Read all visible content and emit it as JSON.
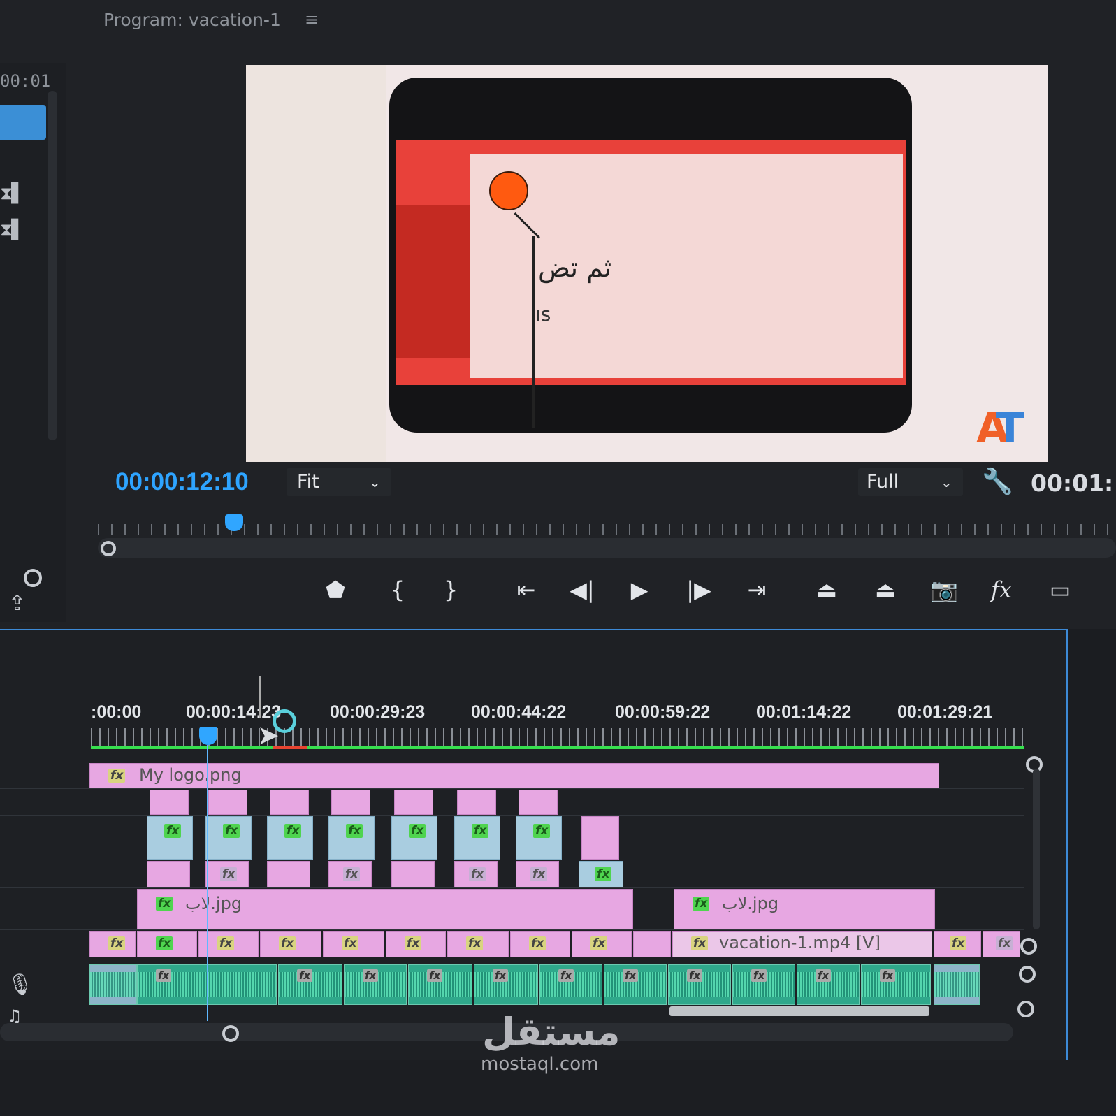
{
  "program_monitor": {
    "title": "Program: vacation-1",
    "menu_icon": "hamburger-icon",
    "current_timecode": "00:00:12:10",
    "fit_select": "Fit",
    "quality_select": "Full",
    "end_timecode": "00:01:",
    "left_panel_timecode": "00:01",
    "overlay_arabic_text": "ثم تض",
    "overlay_sub_text": "ıs",
    "logo_text": "AT",
    "transport_buttons": [
      {
        "name": "add-marker-icon",
        "glyph": "⬟"
      },
      {
        "name": "mark-in-icon",
        "glyph": "{"
      },
      {
        "name": "mark-out-icon",
        "glyph": "}"
      },
      {
        "name": "go-to-in-icon",
        "glyph": "⇤"
      },
      {
        "name": "step-back-icon",
        "glyph": "◀|"
      },
      {
        "name": "play-icon",
        "glyph": "▶"
      },
      {
        "name": "step-forward-icon",
        "glyph": "|▶"
      },
      {
        "name": "go-to-out-icon",
        "glyph": "⇥"
      },
      {
        "name": "lift-icon",
        "glyph": "⏏"
      },
      {
        "name": "extract-icon",
        "glyph": "⏏"
      },
      {
        "name": "export-frame-icon",
        "glyph": "📷"
      },
      {
        "name": "fx-icon",
        "glyph": "fx"
      },
      {
        "name": "safe-margins-icon",
        "glyph": "▭"
      }
    ]
  },
  "timeline": {
    "ruler_labels": [
      ":00:00",
      "00:00:14:23",
      "00:00:29:23",
      "00:00:44:22",
      "00:00:59:22",
      "00:01:14:22",
      "00:01:29:21"
    ],
    "clips": {
      "logo": "My logo.png",
      "image_1": "لاب.jpg",
      "image_2": "لاب.jpg",
      "video": "vacation-1.mp4 [V]"
    },
    "fx_label": "fx"
  },
  "watermark": {
    "arabic": "مستقل",
    "latin": "mostaql.com"
  },
  "colors": {
    "accent_blue": "#2ea4ff",
    "clip_pink": "#e7a7e2",
    "audio_green": "#2fa88b",
    "fx_yellow": "#d9d480",
    "fx_green": "#4fd44f"
  }
}
